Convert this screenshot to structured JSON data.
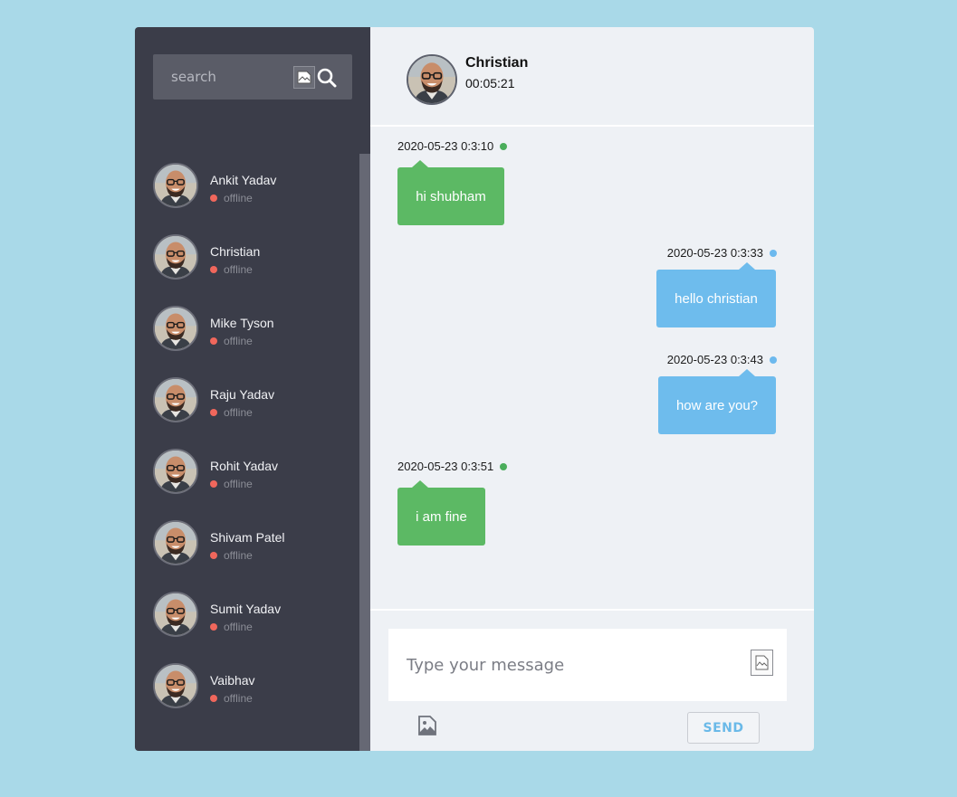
{
  "search": {
    "placeholder": "search"
  },
  "contacts": [
    {
      "name": "Ankit Yadav",
      "status": "offline"
    },
    {
      "name": "Christian",
      "status": "offline"
    },
    {
      "name": "Mike Tyson",
      "status": "offline"
    },
    {
      "name": "Raju Yadav",
      "status": "offline"
    },
    {
      "name": "Rohit Yadav",
      "status": "offline"
    },
    {
      "name": "Shivam Patel",
      "status": "offline"
    },
    {
      "name": "Sumit Yadav",
      "status": "offline"
    },
    {
      "name": "Vaibhav",
      "status": "offline"
    }
  ],
  "chat": {
    "name": "Christian",
    "timer": "00:05:21",
    "messages": [
      {
        "time": "2020-05-23 0:3:10",
        "text": "hi shubham",
        "direction": "received"
      },
      {
        "time": "2020-05-23 0:3:33",
        "text": "hello christian",
        "direction": "sent"
      },
      {
        "time": "2020-05-23 0:3:43",
        "text": "how are you?",
        "direction": "sent"
      },
      {
        "time": "2020-05-23 0:3:51",
        "text": "i am fine",
        "direction": "received"
      }
    ]
  },
  "composer": {
    "placeholder": "Type your message",
    "send_label": "SEND"
  },
  "colors": {
    "background": "#a9d9e8",
    "sidebar": "#3b3d49",
    "received_bubble": "#5cb964",
    "sent_bubble": "#6ebced",
    "offline_dot": "#f0675c",
    "send_text": "#6ab9e8"
  },
  "icons": {
    "search": "search-icon",
    "attach_image": "image-icon",
    "status_offline": "offline-dot-icon"
  }
}
